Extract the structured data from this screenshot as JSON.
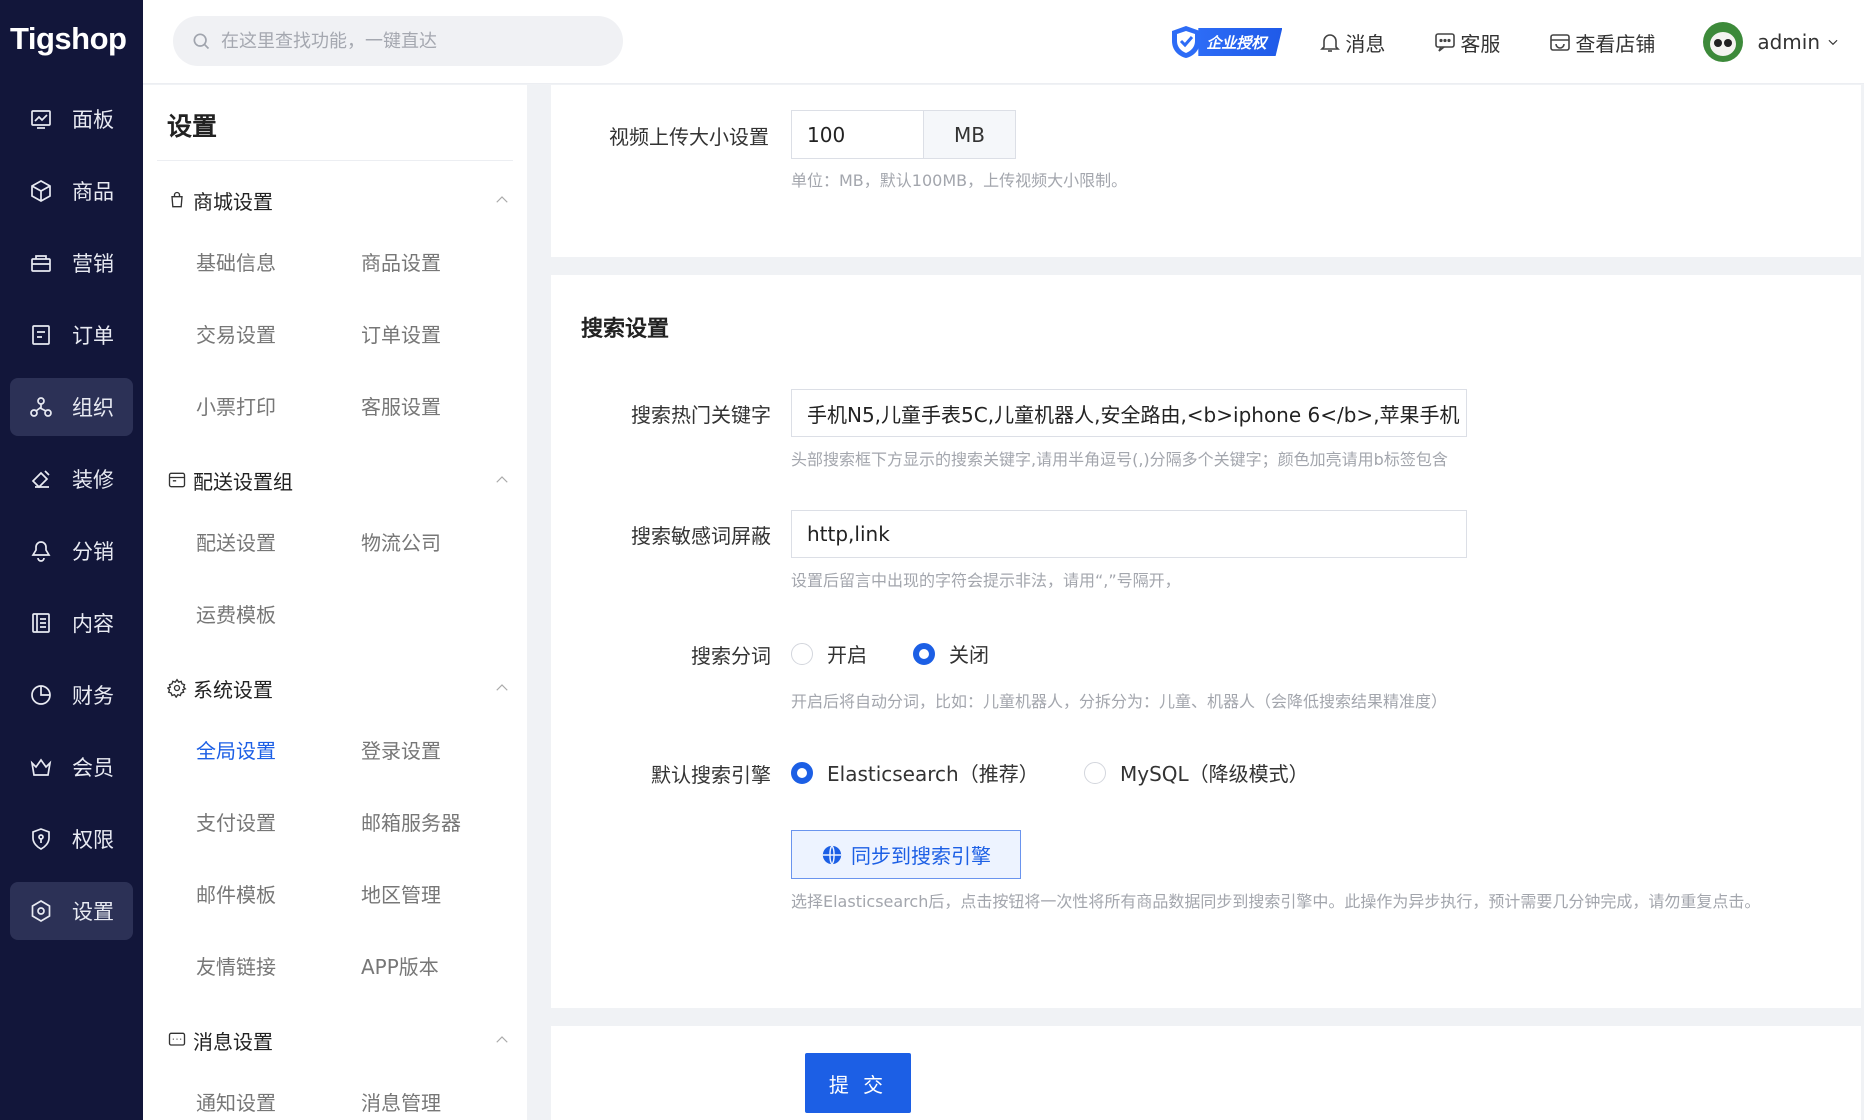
{
  "app": {
    "logo": "Tigshop"
  },
  "nav": [
    {
      "label": "面板",
      "icon": "dashboard-icon"
    },
    {
      "label": "商品",
      "icon": "box-icon"
    },
    {
      "label": "营销",
      "icon": "marketing-icon"
    },
    {
      "label": "订单",
      "icon": "order-icon"
    },
    {
      "label": "组织",
      "icon": "organization-icon"
    },
    {
      "label": "装修",
      "icon": "decorate-icon"
    },
    {
      "label": "分销",
      "icon": "distribution-icon"
    },
    {
      "label": "内容",
      "icon": "content-icon"
    },
    {
      "label": "财务",
      "icon": "finance-icon"
    },
    {
      "label": "会员",
      "icon": "member-icon"
    },
    {
      "label": "权限",
      "icon": "permission-icon"
    },
    {
      "label": "设置",
      "icon": "settings-icon"
    }
  ],
  "header": {
    "search_placeholder": "在这里查找功能，一键直达",
    "enterprise_badge": "企业授权",
    "messages": "消息",
    "service": "客服",
    "view_store": "查看店铺",
    "user_name": "admin"
  },
  "submenu": {
    "title": "设置",
    "groups": [
      {
        "label": "商城设置",
        "items": [
          "基础信息",
          "商品设置",
          "交易设置",
          "订单设置",
          "小票打印",
          "客服设置"
        ]
      },
      {
        "label": "配送设置组",
        "items": [
          "配送设置",
          "物流公司",
          "运费模板"
        ]
      },
      {
        "label": "系统设置",
        "items": [
          "全局设置",
          "登录设置",
          "支付设置",
          "邮箱服务器",
          "邮件模板",
          "地区管理",
          "友情链接",
          "APP版本"
        ]
      },
      {
        "label": "消息设置",
        "items": [
          "通知设置",
          "消息管理"
        ]
      }
    ],
    "active_item": "全局设置"
  },
  "video": {
    "label": "视频上传大小设置",
    "value": "100",
    "unit": "MB",
    "help": "单位：MB，默认100MB，上传视频大小限制。"
  },
  "search_settings": {
    "title": "搜索设置",
    "hot_keywords": {
      "label": "搜索热门关键字",
      "value": "手机N5,儿童手表5C,儿童机器人,安全路由,<b>iphone 6</b>,苹果手机",
      "help": "头部搜索框下方显示的搜索关键字,请用半角逗号(,)分隔多个关键字；颜色加亮请用b标签包含"
    },
    "sensitive": {
      "label": "搜索敏感词屏蔽",
      "value": "http,link",
      "help": "设置后留言中出现的字符会提示非法，请用“,”号隔开，"
    },
    "segmentation": {
      "label": "搜索分词",
      "options": [
        "开启",
        "关闭"
      ],
      "selected": "关闭",
      "help": "开启后将自动分词，比如：儿童机器人，分拆分为：儿童、机器人（会降低搜索结果精准度）"
    },
    "engine": {
      "label": "默认搜索引擎",
      "options": [
        "Elasticsearch（推荐）",
        "MySQL（降级模式）"
      ],
      "selected": "Elasticsearch（推荐）",
      "sync_button": "同步到搜索引擎",
      "help": "选择Elasticsearch后，点击按钮将一次性将所有商品数据同步到搜索引擎中。此操作为异步执行，预计需要几分钟完成，请勿重复点击。"
    }
  },
  "submit": "提 交",
  "colors": {
    "primary": "#1c5fe5",
    "sidebar": "#12163a",
    "sidebar_active": "#2c3156"
  }
}
